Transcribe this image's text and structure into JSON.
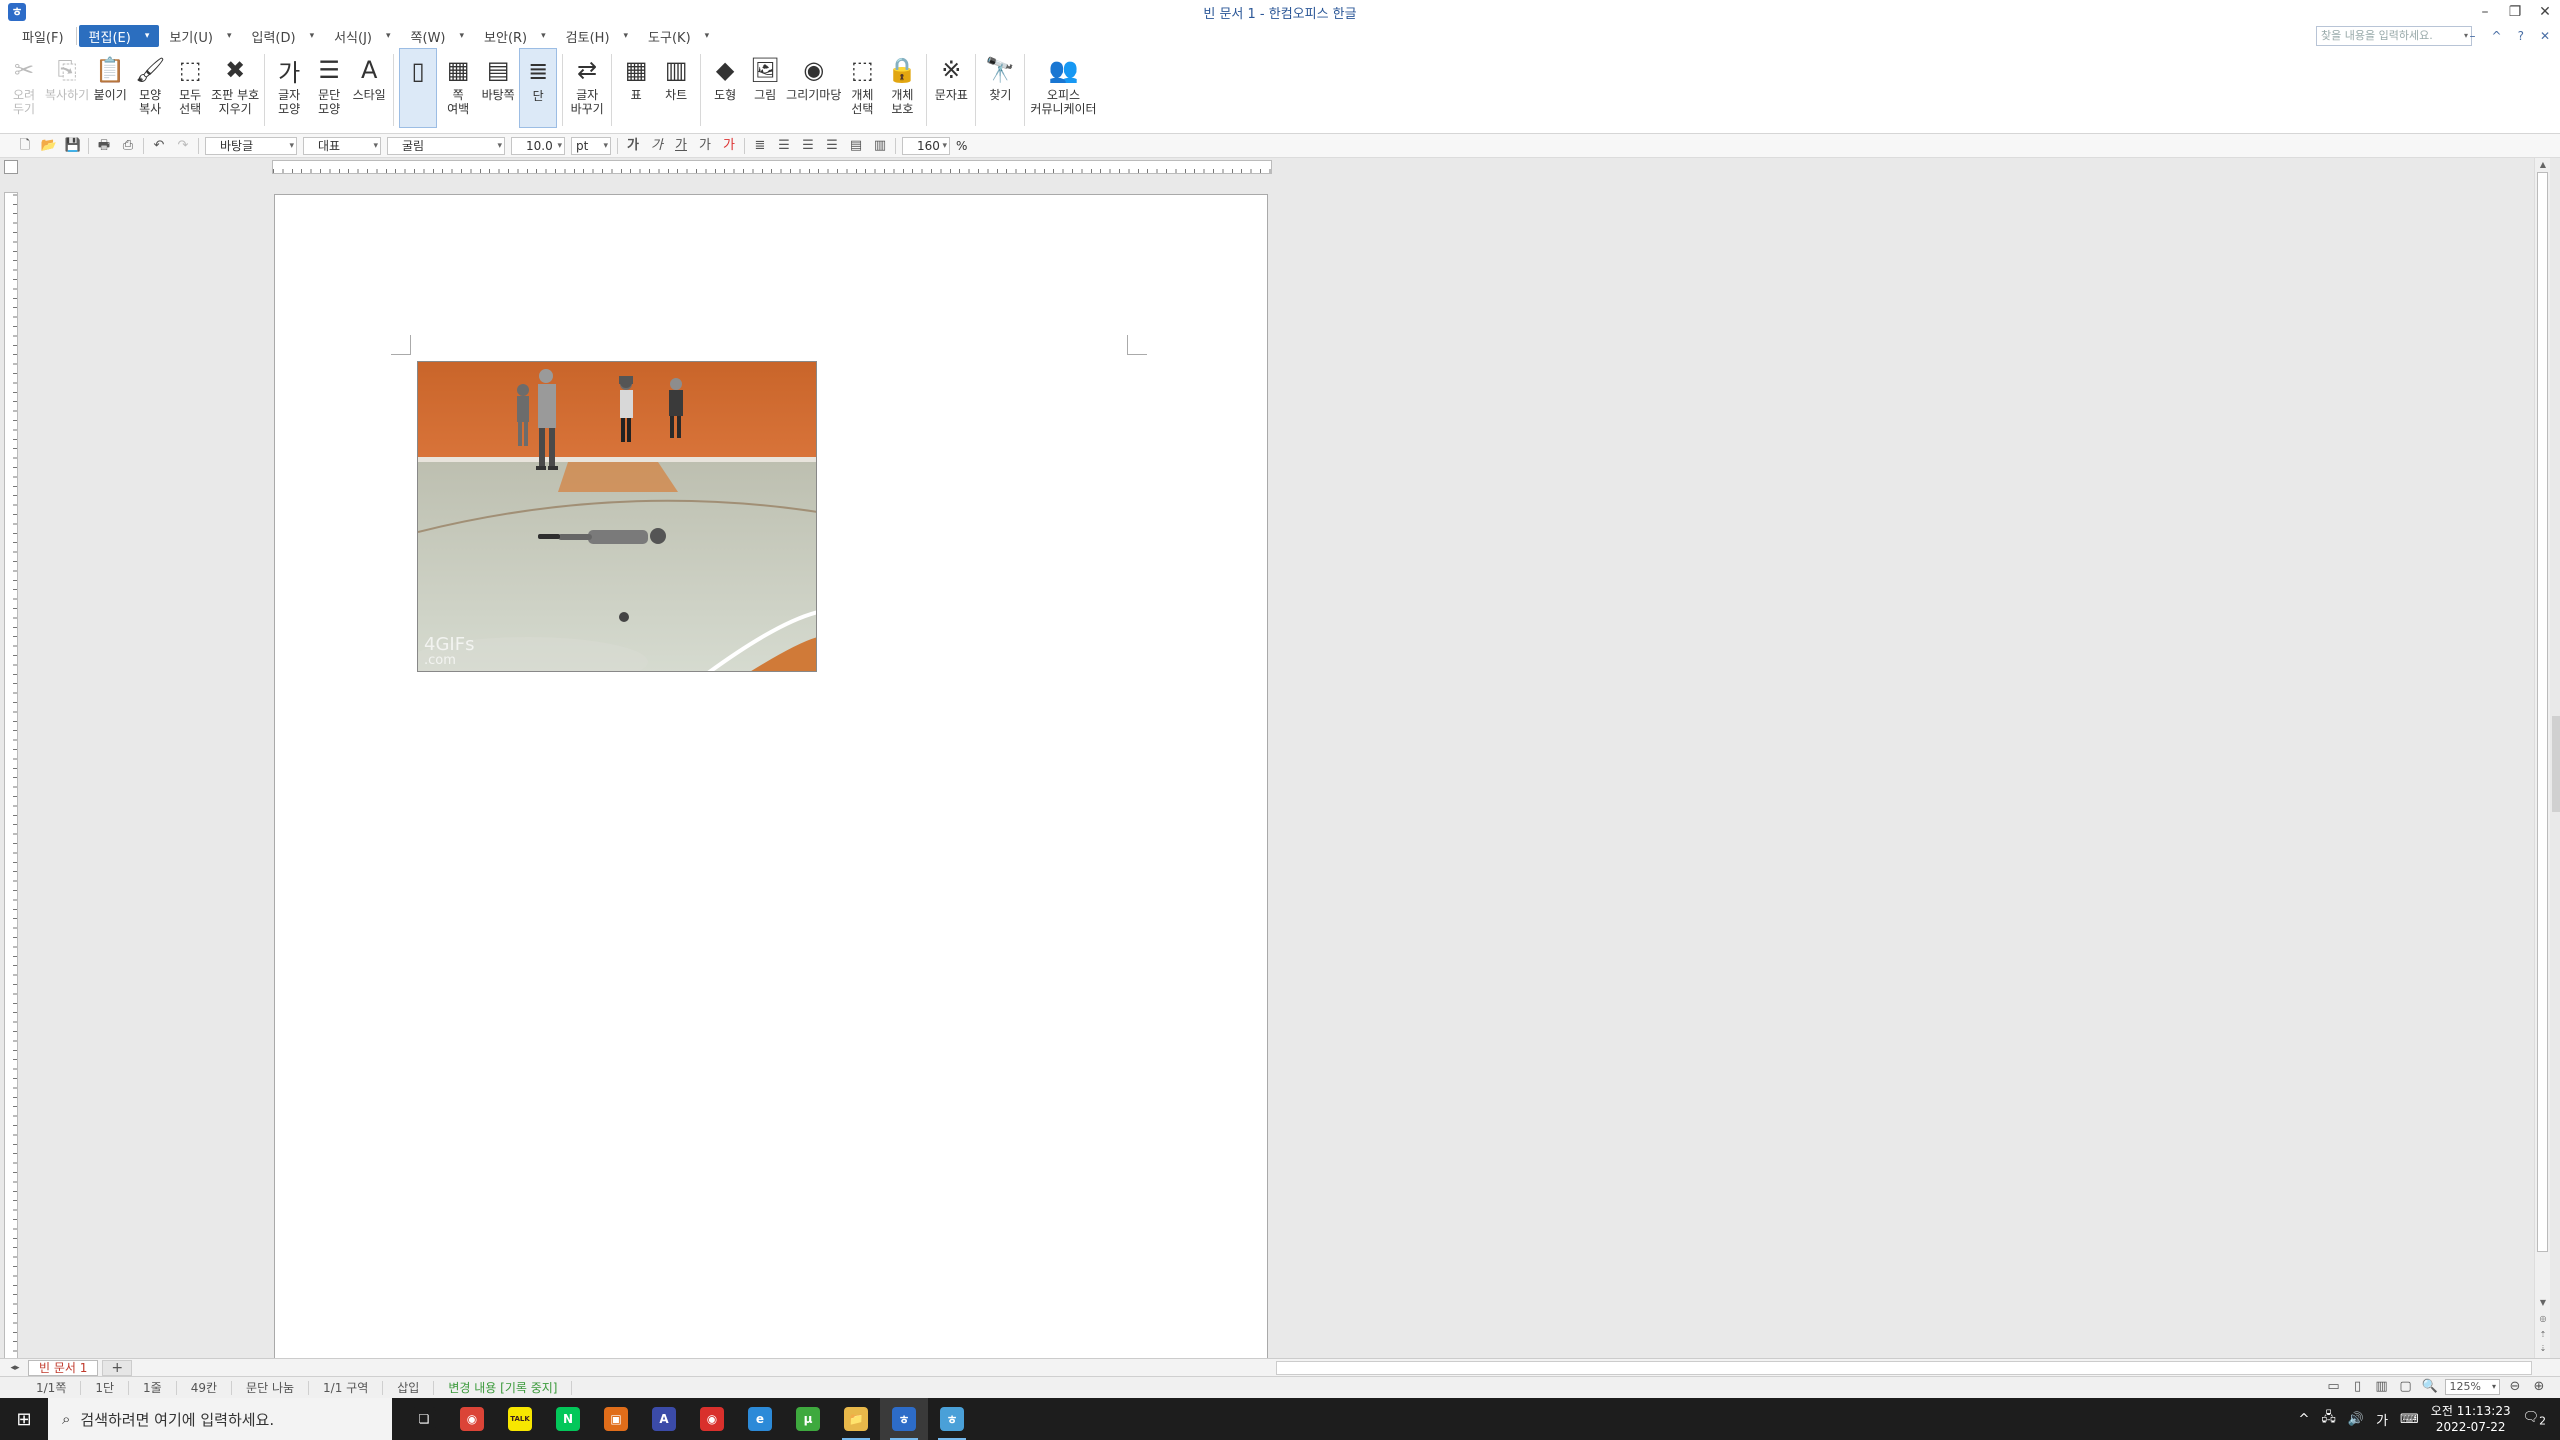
{
  "window": {
    "title": "빈 문서 1 - 한컴오피스 한글",
    "controls": [
      "–",
      "❐",
      "✕"
    ]
  },
  "menu": {
    "items": [
      {
        "label": "파일(F)",
        "arrow": false
      },
      {
        "label": "편집(E)",
        "arrow": true,
        "active": true
      },
      {
        "label": "보기(U)",
        "arrow": true
      },
      {
        "label": "입력(D)",
        "arrow": true
      },
      {
        "label": "서식(J)",
        "arrow": true
      },
      {
        "label": "쪽(W)",
        "arrow": true
      },
      {
        "label": "보안(R)",
        "arrow": true
      },
      {
        "label": "검토(H)",
        "arrow": true
      },
      {
        "label": "도구(K)",
        "arrow": true
      }
    ],
    "search_placeholder": "찾을 내용을 입력하세요.",
    "right_controls": [
      "–",
      "^",
      "?",
      "✕"
    ]
  },
  "ribbon": {
    "buttons": [
      {
        "label": "오려\n두기",
        "icon": "✂",
        "name": "cut",
        "disabled": true
      },
      {
        "label": "복사하기",
        "icon": "⎘",
        "name": "copy",
        "disabled": true
      },
      {
        "label": "붙이기",
        "icon": "📋",
        "name": "paste"
      },
      {
        "label": "모양\n복사",
        "icon": "🖌",
        "name": "format-copy"
      },
      {
        "label": "모두\n선택",
        "icon": "⬚",
        "name": "select-all"
      },
      {
        "label": "조판 부호\n지우기",
        "icon": "✖",
        "name": "clear-codes"
      },
      {
        "sep": true
      },
      {
        "label": "글자\n모양",
        "icon": "가",
        "name": "char-shape"
      },
      {
        "label": "문단\n모양",
        "icon": "☰",
        "name": "para-shape"
      },
      {
        "label": "스타일",
        "icon": "A",
        "name": "style"
      },
      {
        "sep": true
      },
      {
        "label": "",
        "icon": "▯",
        "name": "page-view",
        "sel": true
      },
      {
        "label": "쪽\n여백",
        "icon": "▦",
        "name": "page-margin"
      },
      {
        "label": "바탕쪽",
        "icon": "▤",
        "name": "master-page"
      },
      {
        "label": "단",
        "icon": "≣",
        "name": "columns",
        "sel": true
      },
      {
        "sep": true
      },
      {
        "label": "글자\n바꾸기",
        "icon": "⇄",
        "name": "replace-char"
      },
      {
        "sep": true
      },
      {
        "label": "표",
        "icon": "▦",
        "name": "table"
      },
      {
        "label": "차트",
        "icon": "▥",
        "name": "chart"
      },
      {
        "sep": true
      },
      {
        "label": "도형",
        "icon": "◆",
        "name": "shape"
      },
      {
        "label": "그림",
        "icon": "🖼",
        "name": "picture"
      },
      {
        "label": "그리기마당",
        "icon": "◉",
        "name": "clipart"
      },
      {
        "label": "개체\n선택",
        "icon": "⬚",
        "name": "select-object"
      },
      {
        "label": "개체\n보호",
        "icon": "🔒",
        "name": "protect-object"
      },
      {
        "sep": true
      },
      {
        "label": "문자표",
        "icon": "※",
        "name": "symbols"
      },
      {
        "sep": true
      },
      {
        "label": "찾기",
        "icon": "🔭",
        "name": "find"
      },
      {
        "sep": true
      },
      {
        "label": "오피스\n커뮤니케이터",
        "icon": "👥",
        "name": "communicator"
      }
    ]
  },
  "format_toolbar": {
    "style": "바탕글",
    "language": "대표",
    "font": "굴림",
    "size": "10.0",
    "unit": "pt",
    "line_spacing": "160",
    "line_spacing_unit": "%"
  },
  "document": {
    "image_watermark": "4GIFs",
    "image_watermark_sub": ".com"
  },
  "tabs": {
    "doc_tab": "빈 문서 1",
    "add": "+"
  },
  "status": {
    "page": "1/1쪽",
    "column": "1단",
    "line": "1줄",
    "pos": "49칸",
    "para": "문단 나눔",
    "section": "1/1 구역",
    "mode": "삽입",
    "track": "변경 내용 [기록 중지]",
    "zoom": "125%"
  },
  "taskbar": {
    "search_placeholder": "검색하려면 여기에 입력하세요.",
    "apps": [
      {
        "name": "task-view",
        "glyph": "❏",
        "color": "#1d1d1d"
      },
      {
        "name": "chrome",
        "glyph": "◉",
        "color": "#db4437"
      },
      {
        "name": "kakaotalk",
        "glyph": "TALK",
        "color": "#f7e600"
      },
      {
        "name": "naver",
        "glyph": "N",
        "color": "#03c75a"
      },
      {
        "name": "app-folder",
        "glyph": "▣",
        "color": "#e06d1a"
      },
      {
        "name": "app-a",
        "glyph": "A",
        "color": "#3b4ba8"
      },
      {
        "name": "app-red",
        "glyph": "◉",
        "color": "#d9302c"
      },
      {
        "name": "edge",
        "glyph": "e",
        "color": "#2c8ad8"
      },
      {
        "name": "torrent",
        "glyph": "μ",
        "color": "#3ea93e"
      },
      {
        "name": "explorer",
        "glyph": "📁",
        "color": "#e8b84a"
      },
      {
        "name": "hwp",
        "glyph": "ㅎ",
        "color": "#2d6cc8",
        "active": true
      },
      {
        "name": "hwp-doc",
        "glyph": "ㅎ",
        "color": "#4aa0d8"
      }
    ],
    "clock_time": "오전 11:13:23",
    "clock_date": "2022-07-22",
    "ime": "가",
    "notifications": "2"
  },
  "colors": {
    "menu_active": "#2b6ebf",
    "title_text": "#2b5797",
    "track_text": "#3b9a3b",
    "tab_text": "#c0392b"
  }
}
